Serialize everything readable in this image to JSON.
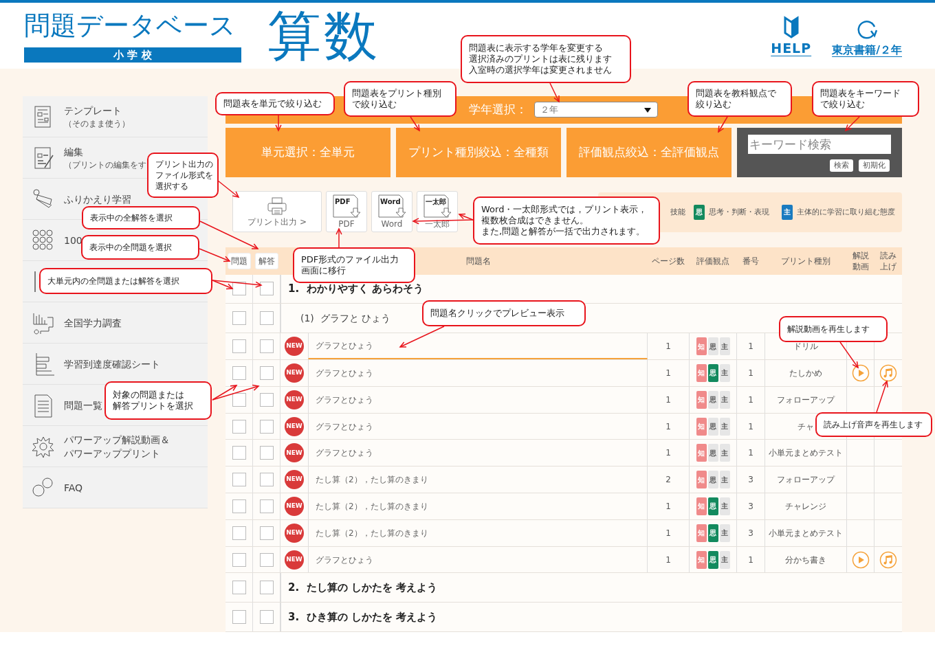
{
  "header": {
    "title": "問題データベース",
    "school": "小 学 校",
    "subject": "算数",
    "help": "HELP",
    "publisher": "東京書籍/２年"
  },
  "sidebar": {
    "items": [
      {
        "kind": "item",
        "label": "テンプレート",
        "sub": "（そのまま使う）"
      },
      {
        "kind": "item",
        "label": "編集",
        "sub": "（プリントの編集をす"
      },
      {
        "kind": "item",
        "label": "ふりかえり学習"
      },
      {
        "kind": "item",
        "label": "100"
      },
      {
        "kind": "covered"
      },
      {
        "kind": "item",
        "label": "全国学力調査"
      },
      {
        "kind": "item",
        "label": "学習到達度確認シート"
      },
      {
        "kind": "item",
        "label": "問題一覧"
      },
      {
        "kind": "item",
        "label": "パワーアップ解説動画＆パワーアッププリント"
      },
      {
        "kind": "item",
        "label": "FAQ"
      }
    ]
  },
  "grade": {
    "label": "学年選択：",
    "value": "２年"
  },
  "filters": [
    {
      "label": "単元選択：全単元"
    },
    {
      "label": "プリント種別絞込：全種類"
    },
    {
      "label": "評価観点絞込：全評価観点"
    }
  ],
  "keyword": {
    "placeholder": "キーワード検索",
    "buttons": [
      "検索",
      "初期化"
    ]
  },
  "outputs": [
    {
      "kind": "print",
      "label": "プリント出力 >"
    },
    {
      "kind": "pdf",
      "label": "PDF",
      "icon_text": "PDF"
    },
    {
      "kind": "word",
      "label": "Word",
      "icon_text": "Word"
    },
    {
      "kind": "ichitaro",
      "label": "一太郎",
      "icon_text": "一太郎"
    }
  ],
  "legend": {
    "partial": "技能",
    "items": [
      {
        "badge": "思",
        "label": "思考・判断・表現",
        "color": "#138a5e"
      },
      {
        "badge": "主",
        "label": "主体的に学習に取り組む態度",
        "color": "#1a7bc0"
      }
    ]
  },
  "table": {
    "select_buttons": [
      "問題",
      "解答"
    ],
    "columns": [
      "問題名",
      "ページ数",
      "評価観点",
      "番号",
      "プリント種別",
      "解説動画",
      "読み上げ"
    ],
    "rows": [
      {
        "kind": "section",
        "title": "1.  わかりやすく あらわそう",
        "q_checked": false,
        "a_checked": false
      },
      {
        "kind": "subsection",
        "title": "(1)  グラフと ひょう",
        "q_checked": false,
        "a_checked": false
      },
      {
        "kind": "problem",
        "badge": "NEW",
        "name": "グラフとひょう",
        "hovered": true,
        "pages": "1",
        "views": [
          {
            "label": "知",
            "on": true
          },
          {
            "label": "思",
            "on": false
          },
          {
            "label": "主",
            "on": false
          }
        ],
        "number": "1",
        "type": "ドリル",
        "video": false,
        "audio": false,
        "q_checked": false,
        "a_checked": false
      },
      {
        "kind": "problem",
        "badge": "NEW",
        "name": "グラフとひょう",
        "hovered": false,
        "pages": "1",
        "views": [
          {
            "label": "知",
            "on": true
          },
          {
            "label": "思",
            "on": true
          },
          {
            "label": "主",
            "on": false
          }
        ],
        "number": "1",
        "type": "たしかめ",
        "video": true,
        "audio": true,
        "q_checked": false,
        "a_checked": false
      },
      {
        "kind": "problem",
        "badge": "NEW",
        "name": "グラフとひょう",
        "hovered": false,
        "pages": "1",
        "views": [
          {
            "label": "知",
            "on": true
          },
          {
            "label": "思",
            "on": false
          },
          {
            "label": "主",
            "on": false
          }
        ],
        "number": "1",
        "type": "フォローアップ",
        "video": false,
        "audio": false,
        "q_checked": false,
        "a_checked": false
      },
      {
        "kind": "problem",
        "badge": "NEW",
        "name": "グラフとひょう",
        "hovered": false,
        "pages": "1",
        "views": [
          {
            "label": "知",
            "on": true
          },
          {
            "label": "思",
            "on": false
          },
          {
            "label": "主",
            "on": false
          }
        ],
        "number": "1",
        "type": "チャ",
        "video": false,
        "audio": false,
        "q_checked": false,
        "a_checked": false
      },
      {
        "kind": "problem",
        "badge": "NEW",
        "name": "グラフとひょう",
        "hovered": false,
        "pages": "1",
        "views": [
          {
            "label": "知",
            "on": true
          },
          {
            "label": "思",
            "on": false
          },
          {
            "label": "主",
            "on": false
          }
        ],
        "number": "1",
        "type": "小単元まとめテスト",
        "video": false,
        "audio": false,
        "q_checked": false,
        "a_checked": false
      },
      {
        "kind": "problem",
        "badge": "NEW",
        "name": "たし算（2），たし算のきまり",
        "hovered": false,
        "pages": "2",
        "views": [
          {
            "label": "知",
            "on": true
          },
          {
            "label": "思",
            "on": false
          },
          {
            "label": "主",
            "on": false
          }
        ],
        "number": "3",
        "type": "フォローアップ",
        "video": false,
        "audio": false,
        "q_checked": false,
        "a_checked": false
      },
      {
        "kind": "problem",
        "badge": "NEW",
        "name": "たし算（2），たし算のきまり",
        "hovered": false,
        "pages": "1",
        "views": [
          {
            "label": "知",
            "on": true
          },
          {
            "label": "思",
            "on": true
          },
          {
            "label": "主",
            "on": false
          }
        ],
        "number": "3",
        "type": "チャレンジ",
        "video": false,
        "audio": false,
        "q_checked": false,
        "a_checked": false
      },
      {
        "kind": "problem",
        "badge": "NEW",
        "name": "たし算（2），たし算のきまり",
        "hovered": false,
        "pages": "1",
        "views": [
          {
            "label": "知",
            "on": true
          },
          {
            "label": "思",
            "on": true
          },
          {
            "label": "主",
            "on": false
          }
        ],
        "number": "3",
        "type": "小単元まとめテスト",
        "video": false,
        "audio": false,
        "q_checked": false,
        "a_checked": false
      },
      {
        "kind": "problem",
        "badge": "NEW",
        "name": "グラフとひょう",
        "hovered": false,
        "pages": "1",
        "views": [
          {
            "label": "知",
            "on": true
          },
          {
            "label": "思",
            "on": true
          },
          {
            "label": "主",
            "on": false
          }
        ],
        "number": "1",
        "type": "分かち書き",
        "video": true,
        "audio": true,
        "q_checked": false,
        "a_checked": false
      },
      {
        "kind": "section",
        "title": "2.  たし算の しかたを 考えよう",
        "q_checked": false,
        "a_checked": false
      },
      {
        "kind": "section",
        "title": "3.  ひき算の しかたを 考えよう",
        "q_checked": false,
        "a_checked": false
      }
    ]
  },
  "callouts": [
    {
      "lines": [
        "問題表を単元で絞り込む"
      ]
    },
    {
      "lines": [
        "問題表をプリント種別",
        "で絞り込む"
      ]
    },
    {
      "lines": [
        "問題表に表示する学年を変更する",
        "選択済みのプリントは表に残ります",
        "入室時の選択学年は変更されません"
      ]
    },
    {
      "lines": [
        "問題表を教科観点で",
        "絞り込む"
      ]
    },
    {
      "lines": [
        "問題表をキーワード",
        "で絞り込む"
      ]
    },
    {
      "lines": [
        "プリント出力の",
        "ファイル形式を",
        "選択する"
      ]
    },
    {
      "lines": [
        "表示中の全解答を選択"
      ]
    },
    {
      "lines": [
        "表示中の全問題を選択"
      ]
    },
    {
      "lines": [
        "大単元内の全問題または解答を選択"
      ]
    },
    {
      "lines": [
        "Word・一太郎形式では，プリント表示，",
        "複数枚合成はできません。",
        "また,問題と解答が一括で出力されます。"
      ]
    },
    {
      "lines": [
        "PDF形式のファイル出力",
        "画面に移行"
      ]
    },
    {
      "lines": [
        "問題名クリックでプレビュー表示"
      ]
    },
    {
      "lines": [
        "解説動画を再生します"
      ]
    },
    {
      "lines": [
        "対象の問題または",
        "解答プリントを選択"
      ]
    },
    {
      "lines": [
        "読み上げ音声を再生します"
      ]
    }
  ]
}
